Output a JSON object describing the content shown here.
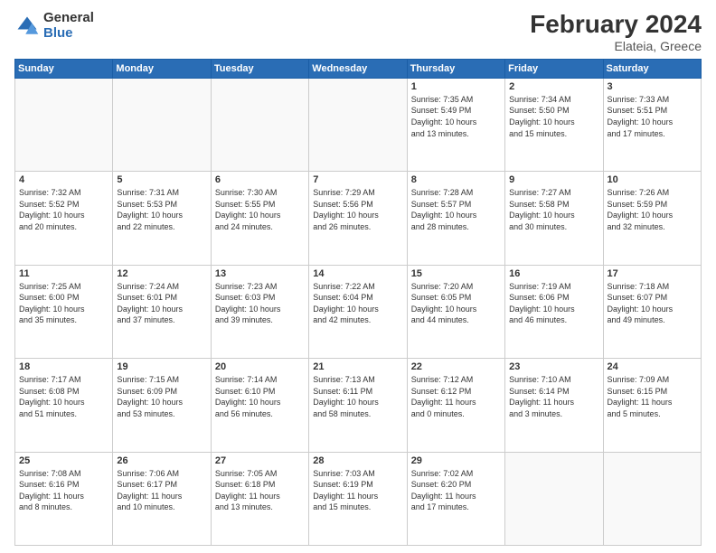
{
  "header": {
    "logo_line1": "General",
    "logo_line2": "Blue",
    "title": "February 2024",
    "subtitle": "Elateia, Greece"
  },
  "weekdays": [
    "Sunday",
    "Monday",
    "Tuesday",
    "Wednesday",
    "Thursday",
    "Friday",
    "Saturday"
  ],
  "weeks": [
    [
      {
        "day": "",
        "info": ""
      },
      {
        "day": "",
        "info": ""
      },
      {
        "day": "",
        "info": ""
      },
      {
        "day": "",
        "info": ""
      },
      {
        "day": "1",
        "info": "Sunrise: 7:35 AM\nSunset: 5:49 PM\nDaylight: 10 hours\nand 13 minutes."
      },
      {
        "day": "2",
        "info": "Sunrise: 7:34 AM\nSunset: 5:50 PM\nDaylight: 10 hours\nand 15 minutes."
      },
      {
        "day": "3",
        "info": "Sunrise: 7:33 AM\nSunset: 5:51 PM\nDaylight: 10 hours\nand 17 minutes."
      }
    ],
    [
      {
        "day": "4",
        "info": "Sunrise: 7:32 AM\nSunset: 5:52 PM\nDaylight: 10 hours\nand 20 minutes."
      },
      {
        "day": "5",
        "info": "Sunrise: 7:31 AM\nSunset: 5:53 PM\nDaylight: 10 hours\nand 22 minutes."
      },
      {
        "day": "6",
        "info": "Sunrise: 7:30 AM\nSunset: 5:55 PM\nDaylight: 10 hours\nand 24 minutes."
      },
      {
        "day": "7",
        "info": "Sunrise: 7:29 AM\nSunset: 5:56 PM\nDaylight: 10 hours\nand 26 minutes."
      },
      {
        "day": "8",
        "info": "Sunrise: 7:28 AM\nSunset: 5:57 PM\nDaylight: 10 hours\nand 28 minutes."
      },
      {
        "day": "9",
        "info": "Sunrise: 7:27 AM\nSunset: 5:58 PM\nDaylight: 10 hours\nand 30 minutes."
      },
      {
        "day": "10",
        "info": "Sunrise: 7:26 AM\nSunset: 5:59 PM\nDaylight: 10 hours\nand 32 minutes."
      }
    ],
    [
      {
        "day": "11",
        "info": "Sunrise: 7:25 AM\nSunset: 6:00 PM\nDaylight: 10 hours\nand 35 minutes."
      },
      {
        "day": "12",
        "info": "Sunrise: 7:24 AM\nSunset: 6:01 PM\nDaylight: 10 hours\nand 37 minutes."
      },
      {
        "day": "13",
        "info": "Sunrise: 7:23 AM\nSunset: 6:03 PM\nDaylight: 10 hours\nand 39 minutes."
      },
      {
        "day": "14",
        "info": "Sunrise: 7:22 AM\nSunset: 6:04 PM\nDaylight: 10 hours\nand 42 minutes."
      },
      {
        "day": "15",
        "info": "Sunrise: 7:20 AM\nSunset: 6:05 PM\nDaylight: 10 hours\nand 44 minutes."
      },
      {
        "day": "16",
        "info": "Sunrise: 7:19 AM\nSunset: 6:06 PM\nDaylight: 10 hours\nand 46 minutes."
      },
      {
        "day": "17",
        "info": "Sunrise: 7:18 AM\nSunset: 6:07 PM\nDaylight: 10 hours\nand 49 minutes."
      }
    ],
    [
      {
        "day": "18",
        "info": "Sunrise: 7:17 AM\nSunset: 6:08 PM\nDaylight: 10 hours\nand 51 minutes."
      },
      {
        "day": "19",
        "info": "Sunrise: 7:15 AM\nSunset: 6:09 PM\nDaylight: 10 hours\nand 53 minutes."
      },
      {
        "day": "20",
        "info": "Sunrise: 7:14 AM\nSunset: 6:10 PM\nDaylight: 10 hours\nand 56 minutes."
      },
      {
        "day": "21",
        "info": "Sunrise: 7:13 AM\nSunset: 6:11 PM\nDaylight: 10 hours\nand 58 minutes."
      },
      {
        "day": "22",
        "info": "Sunrise: 7:12 AM\nSunset: 6:12 PM\nDaylight: 11 hours\nand 0 minutes."
      },
      {
        "day": "23",
        "info": "Sunrise: 7:10 AM\nSunset: 6:14 PM\nDaylight: 11 hours\nand 3 minutes."
      },
      {
        "day": "24",
        "info": "Sunrise: 7:09 AM\nSunset: 6:15 PM\nDaylight: 11 hours\nand 5 minutes."
      }
    ],
    [
      {
        "day": "25",
        "info": "Sunrise: 7:08 AM\nSunset: 6:16 PM\nDaylight: 11 hours\nand 8 minutes."
      },
      {
        "day": "26",
        "info": "Sunrise: 7:06 AM\nSunset: 6:17 PM\nDaylight: 11 hours\nand 10 minutes."
      },
      {
        "day": "27",
        "info": "Sunrise: 7:05 AM\nSunset: 6:18 PM\nDaylight: 11 hours\nand 13 minutes."
      },
      {
        "day": "28",
        "info": "Sunrise: 7:03 AM\nSunset: 6:19 PM\nDaylight: 11 hours\nand 15 minutes."
      },
      {
        "day": "29",
        "info": "Sunrise: 7:02 AM\nSunset: 6:20 PM\nDaylight: 11 hours\nand 17 minutes."
      },
      {
        "day": "",
        "info": ""
      },
      {
        "day": "",
        "info": ""
      }
    ]
  ]
}
